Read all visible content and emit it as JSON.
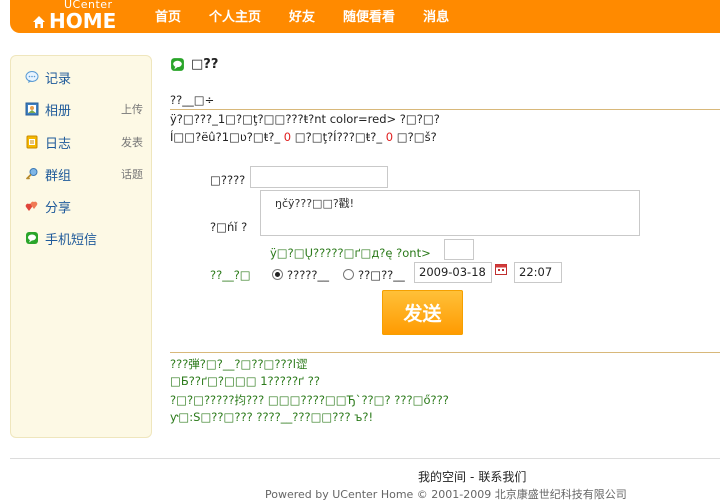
{
  "header": {
    "logo_small": "UCenter",
    "logo_main": "HOME",
    "nav": [
      "首页",
      "个人主页",
      "好友",
      "随便看看",
      "消息"
    ]
  },
  "sidebar": {
    "items": [
      {
        "label": "记录",
        "extra": "",
        "icon": "chat-bubble-icon"
      },
      {
        "label": "相册",
        "extra": "上传",
        "icon": "photo-album-icon"
      },
      {
        "label": "日志",
        "extra": "发表",
        "icon": "blog-notebook-icon"
      },
      {
        "label": "群组",
        "extra": "话题",
        "icon": "group-key-icon"
      },
      {
        "label": "分享",
        "extra": "",
        "icon": "hearts-icon"
      },
      {
        "label": "手机短信",
        "extra": "",
        "icon": "green-sms-icon"
      }
    ]
  },
  "main": {
    "title": "□??",
    "line1": "??__□÷",
    "line2": "ÿ?□???_1□?□ţ?□□???ŧ?nt color=red> ?□?□?",
    "line3_a": "Í□□?ëû?1□ʋ?□ŧ?_ ",
    "line3_b": "0",
    "line3_c": " □?□ţ?Í???□ŧ?_ ",
    "line3_d": "0",
    "line3_e": " □?□š?",
    "form": {
      "label1": "□????",
      "input1_value": "",
      "label2": "?□ńǐ ?",
      "textarea_value": "ŋčÿ???□□?戳!",
      "green_line": "ÿ□?□Ų?????□ґ□д?ę ?ont>",
      "small_input_value": "",
      "label3": "??__?□",
      "radio1_label": "?????__",
      "radio2_label": "??□??__",
      "date_value": "2009-03-18",
      "time_value": "22:07",
      "send_label": "发送"
    },
    "notes": [
      "???弾?□?__?□??□???l䜧",
      "□Б??ґ□?□□□ 1?????ґ ??",
      "?□?□?????抣??? □□□????□□Ђ`??□?   ???□ő???",
      "ƴ□:S□??□???   ????__???□□???      ъ?!"
    ]
  },
  "footer": {
    "link1": "我的空间",
    "sep": "-",
    "link2": "联系我们",
    "copyright": "Powered by UCenter Home © 2001-2009 北京康盛世纪科技有限公司"
  },
  "colors": {
    "header_orange": "#ff8a00",
    "sidebar_bg": "#fdf9e5",
    "link_blue": "#1f5a9a",
    "note_green": "#2b7a1a",
    "count_red": "#e02020"
  }
}
